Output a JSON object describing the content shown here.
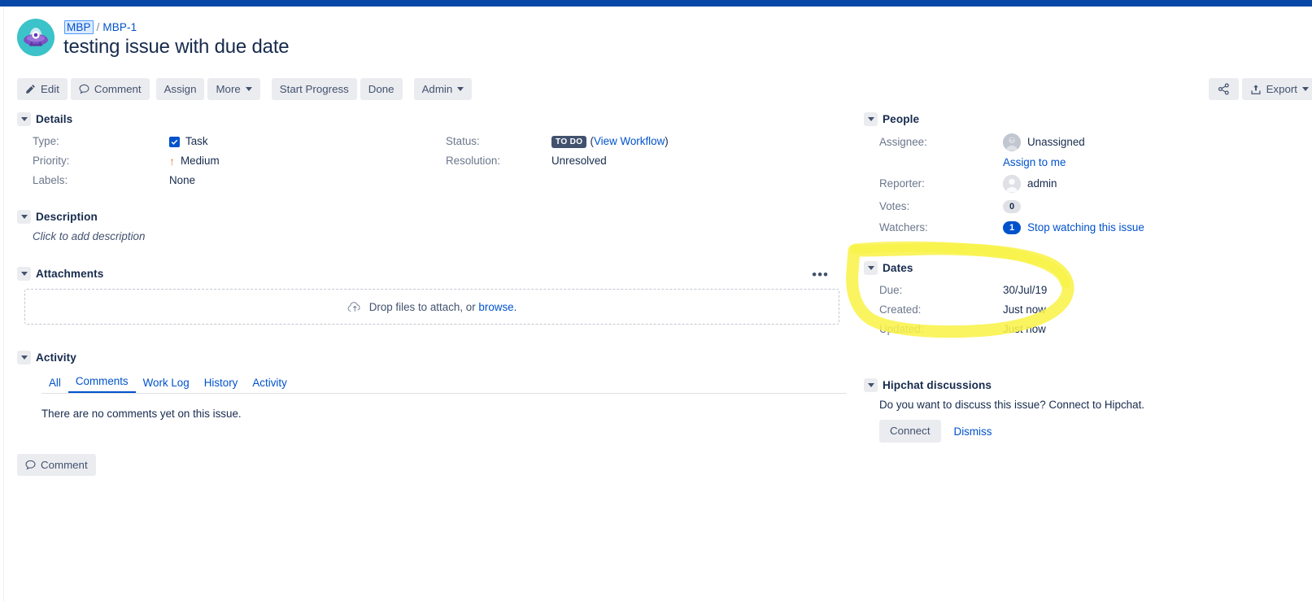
{
  "colors": {
    "topbar": "#0747a6",
    "link": "#0052cc",
    "text": "#172b4d",
    "muted": "#6b778c",
    "button_bg": "#ebecf0",
    "status_badge_bg": "#42526e",
    "highlight": "#f9f24a",
    "avatar_teal": "#3cc3c9",
    "avatar_purple": "#6b49b8",
    "priority_orange": "#e97f33"
  },
  "header": {
    "project_key": "MBP",
    "separator": "/",
    "issue_key": "MBP-1",
    "title": "testing issue with due date",
    "avatar_icon": "project-ufo-avatar"
  },
  "toolbar": {
    "edit": "Edit",
    "comment": "Comment",
    "assign": "Assign",
    "more": "More",
    "start_progress": "Start Progress",
    "done": "Done",
    "admin": "Admin",
    "share_icon": "share-icon",
    "export": "Export"
  },
  "details": {
    "title": "Details",
    "rows": [
      {
        "label": "Type:",
        "value": "Task"
      },
      {
        "label": "Priority:",
        "value": "Medium"
      },
      {
        "label": "Labels:",
        "value": "None"
      }
    ],
    "status_label": "Status:",
    "status_value": "TO DO",
    "view_workflow": "View Workflow",
    "paren_open": "(",
    "paren_close": ")",
    "resolution_label": "Resolution:",
    "resolution_value": "Unresolved"
  },
  "description": {
    "title": "Description",
    "placeholder": "Click to add description"
  },
  "attachments": {
    "title": "Attachments",
    "dots": "•••",
    "drop_text": "Drop files to attach, or",
    "browse_text": "browse.",
    "upload_icon": "cloud-upload-icon"
  },
  "activity": {
    "title": "Activity",
    "tabs": [
      {
        "label": "All",
        "active": false
      },
      {
        "label": "Comments",
        "active": true
      },
      {
        "label": "Work Log",
        "active": false
      },
      {
        "label": "History",
        "active": false
      },
      {
        "label": "Activity",
        "active": false
      }
    ],
    "empty_text": "There are no comments yet on this issue.",
    "comment_button": "Comment"
  },
  "people": {
    "title": "People",
    "assignee_label": "Assignee:",
    "assignee_value": "Unassigned",
    "assign_to_me": "Assign to me",
    "reporter_label": "Reporter:",
    "reporter_value": "admin",
    "votes_label": "Votes:",
    "votes_value": "0",
    "watchers_label": "Watchers:",
    "watchers_value": "1",
    "watch_link": "Stop watching this issue"
  },
  "dates": {
    "title": "Dates",
    "rows": [
      {
        "label": "Due:",
        "value": "30/Jul/19"
      },
      {
        "label": "Created:",
        "value": "Just now"
      },
      {
        "label": "Updated:",
        "value": "Just now"
      }
    ]
  },
  "hipchat": {
    "title": "Hipchat discussions",
    "prompt": "Do you want to discuss this issue? Connect to Hipchat.",
    "connect": "Connect",
    "dismiss": "Dismiss"
  },
  "annotation": {
    "shape": "hand-drawn-yellow-ellipse",
    "target": "Dates section"
  }
}
